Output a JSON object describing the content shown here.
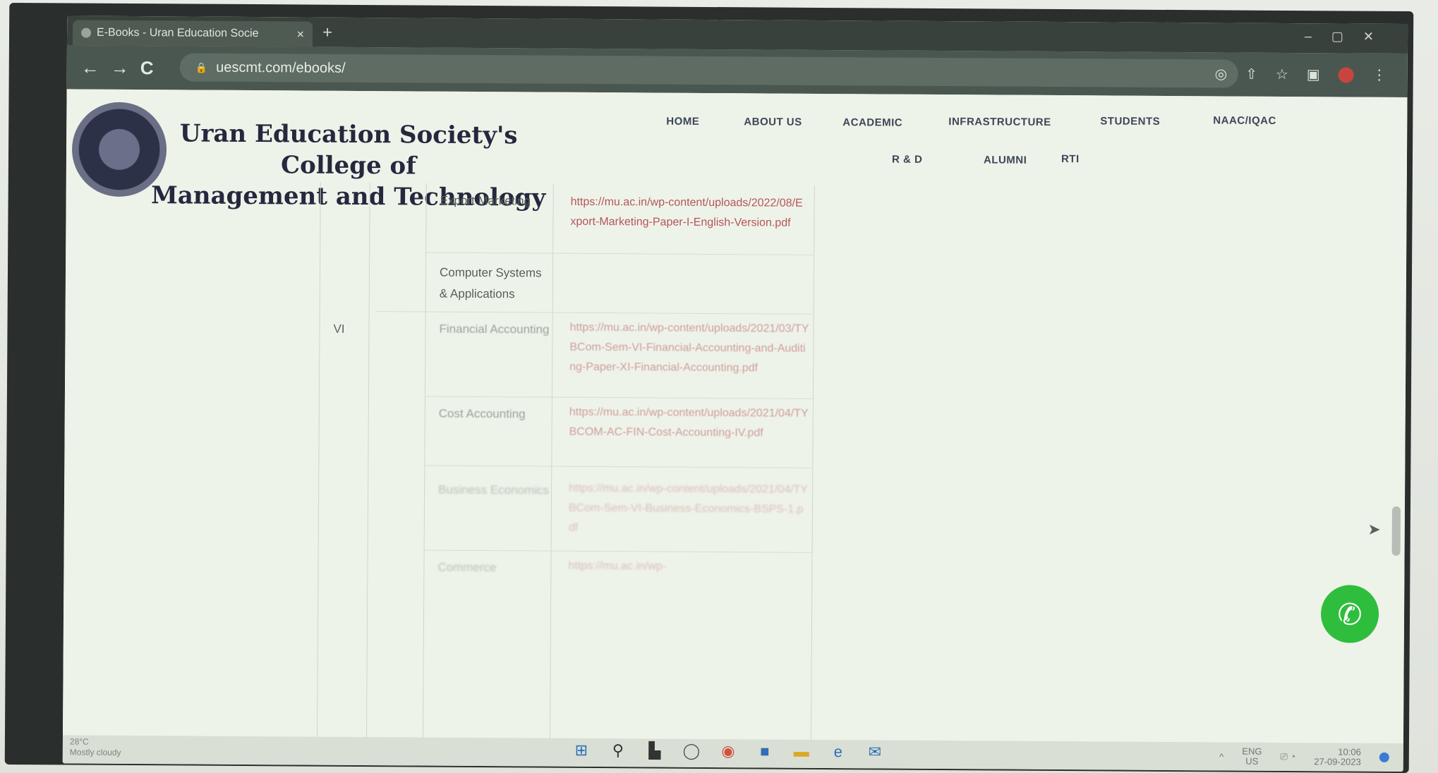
{
  "browser": {
    "tab_title": "E-Books - Uran Education Socie",
    "tab_close": "×",
    "new_tab": "+",
    "url": "uescmt.com/ebooks/",
    "back": "←",
    "forward": "→",
    "reload": "C",
    "lock": "🔒"
  },
  "site": {
    "college_name_line1": "Uran Education Society's College of",
    "college_name_line2": "Management and Technology",
    "nav": [
      "HOME",
      "ABOUT US",
      "ACADEMIC",
      "INFRASTRUCTURE",
      "STUDENTS",
      "NAAC/IQAC",
      "R & D",
      "ALUMNI",
      "RTI"
    ]
  },
  "table": {
    "rows": [
      {
        "sem": "",
        "subject": "Export Marketing",
        "link": "https://mu.ac.in/wp-content/uploads/2022/08/Export-Marketing-Paper-I-English-Version.pdf"
      },
      {
        "sem": "",
        "subject": "Computer Systems & Applications",
        "link": ""
      },
      {
        "sem": "VI",
        "subject": "Financial Accounting",
        "link": "https://mu.ac.in/wp-content/uploads/2021/03/TYBCom-Sem-VI-Financial-Accounting-and-Auditing-Paper-XI-Financial-Accounting.pdf"
      },
      {
        "sem": "",
        "subject": "Cost Accounting",
        "link": "https://mu.ac.in/wp-content/uploads/2021/04/TYBCOM-AC-FIN-Cost-Accounting-IV.pdf"
      },
      {
        "sem": "",
        "subject": "Business Economics",
        "link": "https://mu.ac.in/wp-content/uploads/2021/04/TYBCom-Sem-VI-Business-Economics-BSPS-1.pdf"
      },
      {
        "sem": "",
        "subject": "Commerce",
        "link": "https://mu.ac.in/wp-"
      }
    ]
  },
  "whatsapp_icon": "whatsapp-icon",
  "taskbar": {
    "weather_temp": "28°C",
    "weather_desc": "Mostly cloudy",
    "lang": "ENG",
    "region": "US",
    "time": "10:06",
    "date": "27-09-2023"
  }
}
